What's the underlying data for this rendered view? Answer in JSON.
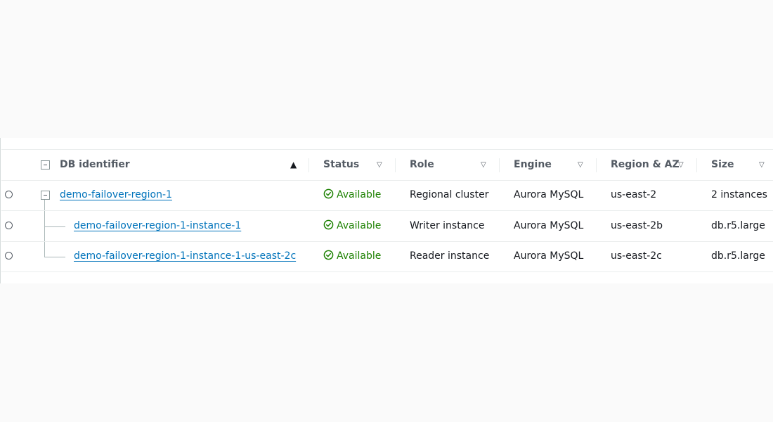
{
  "colors": {
    "link": "#0073bb",
    "status_available": "#1d8102",
    "header_text": "#545b64",
    "border": "#eaeded"
  },
  "table": {
    "columns": [
      {
        "label": "DB identifier",
        "sort": "ascending"
      },
      {
        "label": "Status",
        "sort": "none"
      },
      {
        "label": "Role",
        "sort": "none"
      },
      {
        "label": "Engine",
        "sort": "none"
      },
      {
        "label": "Region & AZ",
        "sort": "none"
      },
      {
        "label": "Size",
        "sort": "none"
      }
    ],
    "rows": [
      {
        "db_identifier": "demo-failover-region-1",
        "status": "Available",
        "role": "Regional cluster",
        "engine": "Aurora MySQL",
        "region_az": "us-east-2",
        "size": "2 instances"
      },
      {
        "db_identifier": "demo-failover-region-1-instance-1",
        "status": "Available",
        "role": "Writer instance",
        "engine": "Aurora MySQL",
        "region_az": "us-east-2b",
        "size": "db.r5.large"
      },
      {
        "db_identifier": "demo-failover-region-1-instance-1-us-east-2c",
        "status": "Available",
        "role": "Reader instance",
        "engine": "Aurora MySQL",
        "region_az": "us-east-2c",
        "size": "db.r5.large"
      }
    ]
  },
  "icons": {
    "status": "check-circle-icon",
    "sort_asc": "caret-up-icon",
    "sort_none": "caret-down-outline-icon",
    "collapse": "collapse-minus-icon"
  }
}
